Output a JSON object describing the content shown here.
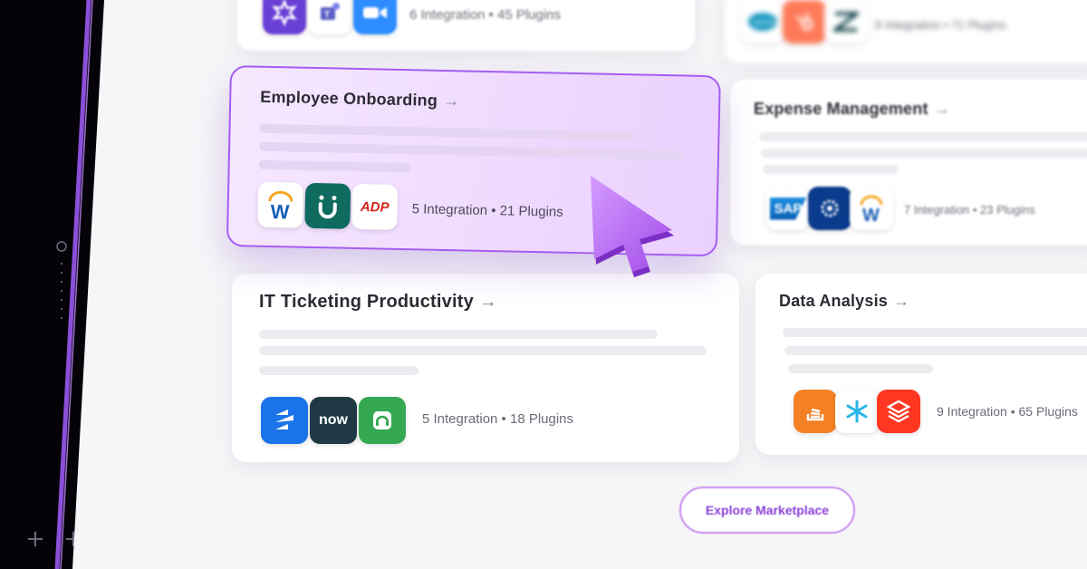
{
  "cards": {
    "top_left": {
      "meta": "6 Integration • 45 Plugins"
    },
    "top_right": {
      "meta": "8 Integration • 71 Plugins"
    },
    "employee_onboarding": {
      "title": "Employee Onboarding",
      "meta": "5 Integration • 21 Plugins",
      "icons": [
        "workday-icon",
        "unito-icon",
        "adp-icon"
      ],
      "icon_text": {
        "workday": "W",
        "adp": "ADP"
      }
    },
    "expense_management": {
      "title": "Expense Management",
      "meta": "7 Integration • 23 Plugins",
      "icon_text": {
        "sap": "SAP",
        "workday": "W"
      }
    },
    "it_ticketing": {
      "title": "IT Ticketing Productivity",
      "meta": "5 Integration • 18 Plugins",
      "icon_text": {
        "now": "now"
      }
    },
    "data_analysis": {
      "title": "Data Analysis",
      "meta": "9 Integration • 65 Plugins"
    }
  },
  "arrow_glyph": "→",
  "explore_button": "Explore Marketplace",
  "colors": {
    "accent": "#a55cf0",
    "cursor": "#b56af5",
    "explore_text": "#8a3fd9"
  }
}
